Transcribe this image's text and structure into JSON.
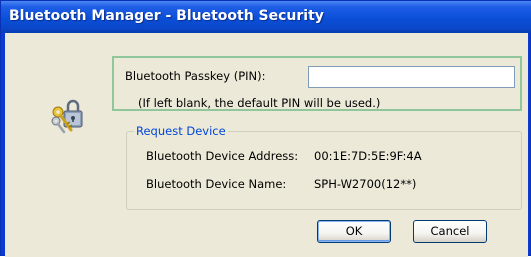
{
  "window": {
    "title": "Bluetooth Manager - Bluetooth Security"
  },
  "passkey": {
    "label": "Bluetooth Passkey (PIN):",
    "value": "",
    "hint": "(If left blank, the default PIN will be used.)"
  },
  "request_device": {
    "group_label": "Request Device",
    "address_label": "Bluetooth Device Address:",
    "address_value": "00:1E:7D:5E:9F:4A",
    "name_label": "Bluetooth Device Name:",
    "name_value": "SPH-W2700(12**)"
  },
  "buttons": {
    "ok_label": "OK",
    "cancel_label": "Cancel"
  },
  "icons": {
    "dialog_icon": "keys-lock-icon"
  }
}
